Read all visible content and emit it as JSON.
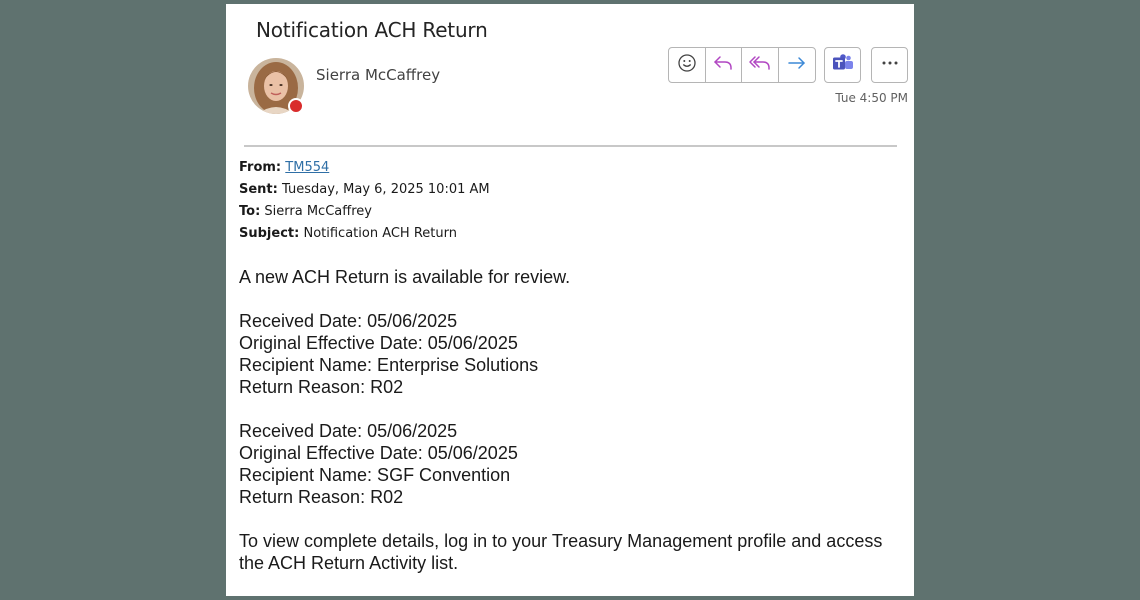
{
  "message": {
    "title": "Notification ACH Return",
    "sender_name": "Sierra McCaffrey",
    "timestamp": "Tue 4:50 PM"
  },
  "actions": {
    "emoji_icon": "smiley-icon",
    "reply_icon": "reply-icon",
    "reply_all_icon": "reply-all-icon",
    "forward_icon": "forward-icon",
    "teams_icon": "teams-icon",
    "more_icon": "more-icon"
  },
  "colors": {
    "background": "#5f726f",
    "reply_accent": "#b146c2",
    "forward_accent": "#3b88d6",
    "teams_accent": "#5059c9",
    "presence_busy": "#d92c2c",
    "link": "#2f6fa6"
  },
  "headers": {
    "from_label": "From:",
    "from_value": "TM554",
    "sent_label": "Sent:",
    "sent_value": "Tuesday, May 6, 2025 10:01 AM",
    "to_label": "To:",
    "to_value": "Sierra McCaffrey",
    "subject_label": "Subject:",
    "subject_value": "Notification ACH Return"
  },
  "body": {
    "intro": "A new ACH Return is available for review.",
    "returns": [
      {
        "received": "Received Date: 05/06/2025",
        "original_effective": "Original Effective Date: 05/06/2025",
        "recipient": "Recipient Name: Enterprise Solutions",
        "reason": "Return Reason: R02"
      },
      {
        "received": "Received Date: 05/06/2025",
        "original_effective": "Original Effective Date: 05/06/2025",
        "recipient": "Recipient Name: SGF Convention",
        "reason": "Return Reason: R02"
      }
    ],
    "closing": "To view complete details, log in to your Treasury Management profile and access the ACH Return Activity list."
  }
}
